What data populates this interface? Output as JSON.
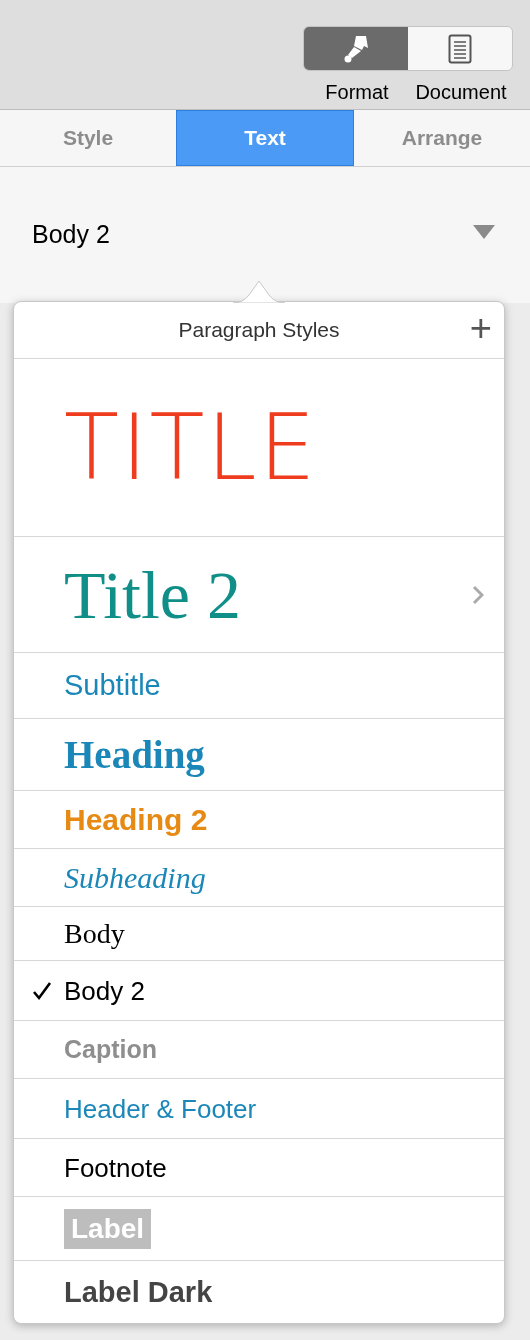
{
  "toolbar": {
    "buttons": [
      {
        "label": "Format",
        "selected": true
      },
      {
        "label": "Document",
        "selected": false
      }
    ]
  },
  "tabs": [
    {
      "label": "Style",
      "selected": false
    },
    {
      "label": "Text",
      "selected": true
    },
    {
      "label": "Arrange",
      "selected": false
    }
  ],
  "style_dropdown": {
    "value": "Body 2"
  },
  "popover": {
    "title": "Paragraph Styles",
    "add_button": "+",
    "styles": [
      {
        "name": "TITLE",
        "kind": "title",
        "selected": false,
        "submenu": false
      },
      {
        "name": "Title 2",
        "kind": "title2",
        "selected": false,
        "submenu": true
      },
      {
        "name": "Subtitle",
        "kind": "subtitle",
        "selected": false,
        "submenu": false
      },
      {
        "name": "Heading",
        "kind": "heading",
        "selected": false,
        "submenu": false
      },
      {
        "name": "Heading 2",
        "kind": "heading2",
        "selected": false,
        "submenu": false
      },
      {
        "name": "Subheading",
        "kind": "subheading",
        "selected": false,
        "submenu": false
      },
      {
        "name": "Body",
        "kind": "body",
        "selected": false,
        "submenu": false
      },
      {
        "name": "Body 2",
        "kind": "body2",
        "selected": true,
        "submenu": false
      },
      {
        "name": "Caption",
        "kind": "caption",
        "selected": false,
        "submenu": false
      },
      {
        "name": "Header & Footer",
        "kind": "header_footer",
        "selected": false,
        "submenu": false
      },
      {
        "name": "Footnote",
        "kind": "footnote",
        "selected": false,
        "submenu": false
      },
      {
        "name": "Label",
        "kind": "label",
        "selected": false,
        "submenu": false
      },
      {
        "name": "Label Dark",
        "kind": "label_dark",
        "selected": false,
        "submenu": false
      }
    ]
  }
}
